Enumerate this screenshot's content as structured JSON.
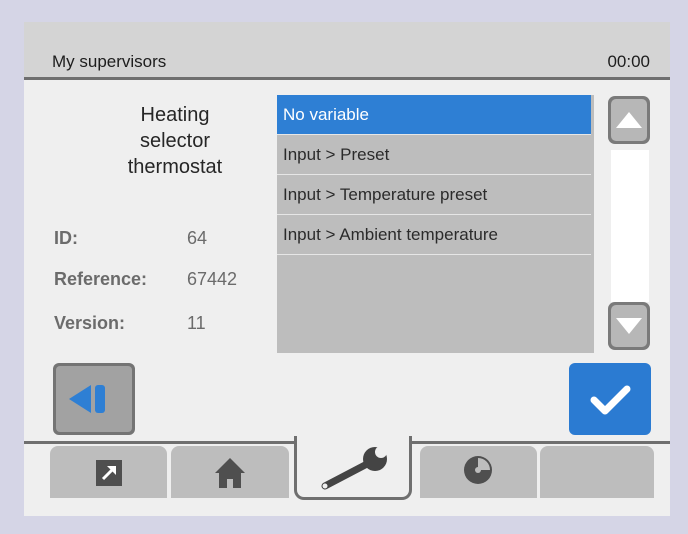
{
  "header": {
    "title": "My supervisors",
    "time": "00:00"
  },
  "device": {
    "name_lines": [
      "Heating",
      "selector",
      "thermostat"
    ],
    "info": [
      {
        "label": "ID:",
        "value": "64"
      },
      {
        "label": "Reference:",
        "value": "67442"
      },
      {
        "label": "Version:",
        "value": "11"
      }
    ]
  },
  "variables": {
    "selected_index": 0,
    "items": [
      "No variable",
      "Input > Preset",
      "Input > Temperature preset",
      "Input > Ambient temperature"
    ]
  },
  "buttons": {
    "back_icon": "back-arrow-icon",
    "confirm_icon": "checkmark-icon",
    "scroll_up_icon": "triangle-up-icon",
    "scroll_down_icon": "triangle-down-icon"
  },
  "tabs": [
    {
      "icon": "external-arrow-icon",
      "active": false
    },
    {
      "icon": "home-icon",
      "active": false
    },
    {
      "icon": "wrench-icon",
      "active": true
    },
    {
      "icon": "disc-icon",
      "active": false
    },
    {
      "icon": "",
      "active": false
    }
  ],
  "colors": {
    "accent": "#2e7fd4",
    "background": "#d5d5e6",
    "panel": "#efefef",
    "list_bg": "#bdbdbd"
  }
}
